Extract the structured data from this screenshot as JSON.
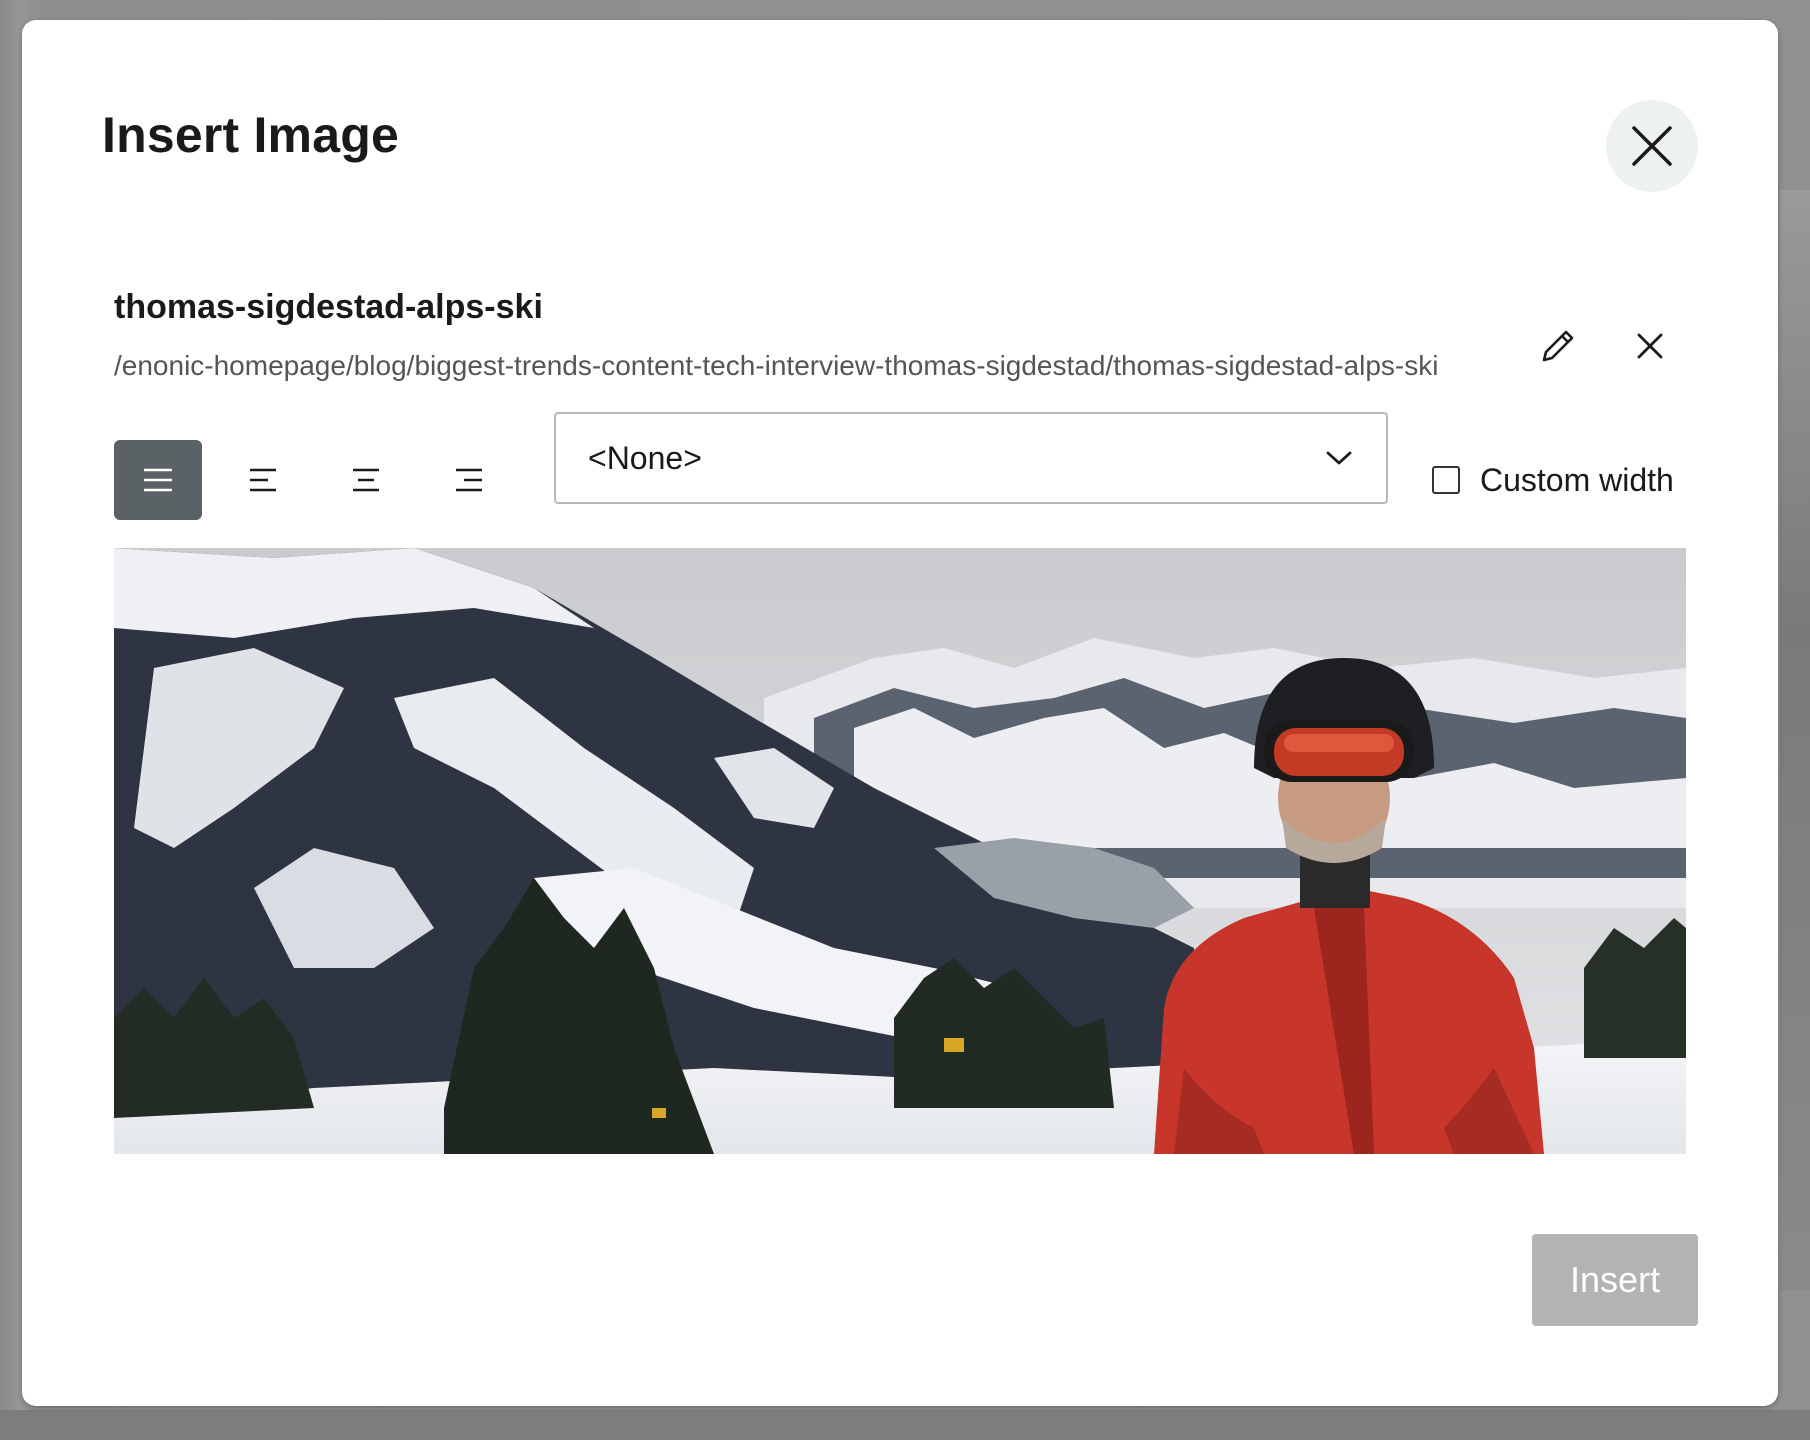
{
  "dialog": {
    "title": "Insert Image",
    "close_icon": "close-icon"
  },
  "selected_image": {
    "name": "thomas-sigdestad-alps-ski",
    "path": "/enonic-homepage/blog/biggest-trends-content-tech-interview-thomas-sigdestad/thomas-sigdestad-alps-ski",
    "edit_icon": "pencil-icon",
    "remove_icon": "close-icon"
  },
  "alignment": {
    "options": [
      "justify",
      "left",
      "center",
      "right"
    ],
    "selected": "justify",
    "active_color": "#5a6266"
  },
  "style_select": {
    "value": "<None>",
    "icon": "chevron-down-icon"
  },
  "custom_width": {
    "label": "Custom width",
    "checked": false
  },
  "footer": {
    "insert_label": "Insert",
    "insert_enabled": false,
    "insert_color": "#b3b3b3"
  }
}
